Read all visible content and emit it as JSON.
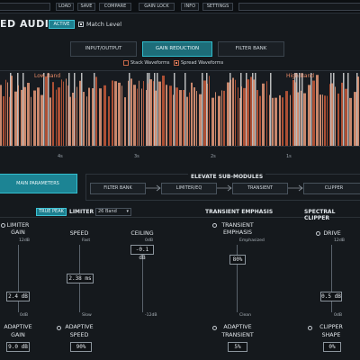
{
  "toolbar": {
    "items": [
      "LOAD",
      "SAVE",
      "COMPARE",
      "GAIN LOCK",
      "INFO",
      "SETTINGS"
    ]
  },
  "header": {
    "brand": "ED AUDIO",
    "active_label": "ACTIVE",
    "match_level_label": "Match Level"
  },
  "tabs": [
    {
      "label": "INPUT/OUTPUT"
    },
    {
      "label": "GAIN REDUCTION"
    },
    {
      "label": "FILTER BANK"
    }
  ],
  "waveform_options": {
    "stack_label": "Stack Waveforms",
    "spread_label": "Spread Waveforms"
  },
  "graph": {
    "low_band_label": "Low Band",
    "high_band_label": "High Band",
    "time_labels": [
      "4s",
      "3s",
      "2s",
      "1s"
    ],
    "colors": {
      "wave": "#c8593a",
      "wave_light": "#e89a7a",
      "bars": "#e3e3e3"
    }
  },
  "modules": {
    "main_params_label": "MAIN PARAMETERS",
    "title": "ELEVATE SUB-MODULES",
    "items": [
      "FILTER BANK",
      "LIMITER/EQ",
      "TRANSIENT",
      "CLIPPER"
    ]
  },
  "limiter": {
    "true_peak_label": "TRUE PEAK",
    "title": "LIMITER",
    "band_select": "26 Band",
    "gain": {
      "label1": "LIMITER",
      "label2": "GAIN",
      "top": "12dB",
      "bottom": "0dB",
      "value": "2.4 dB"
    },
    "speed": {
      "label": "SPEED",
      "top": "Fast",
      "bottom": "Slow",
      "value": "2.38 ms"
    },
    "ceiling": {
      "label": "CEILING",
      "top": "0dB",
      "bottom": "-12dB",
      "value": "-0.1 dB"
    },
    "adaptive_gain": {
      "label1": "ADAPTIVE",
      "label2": "GAIN",
      "value": "9.0 dB"
    },
    "adaptive_speed": {
      "label1": "ADAPTIVE",
      "label2": "SPEED",
      "value": "90%"
    }
  },
  "transient": {
    "title": "TRANSIENT EMPHASIS",
    "emph": {
      "label1": "TRANSIENT",
      "label2": "EMPHASIS",
      "top": "Emphasized",
      "bottom": "Clean",
      "value": "80%"
    },
    "adaptive": {
      "label1": "ADAPTIVE",
      "label2": "TRANSIENT",
      "value": "5%"
    }
  },
  "clipper": {
    "title": "SPECTRAL CLIPPER",
    "drive": {
      "label": "DRIVE",
      "top": "12dB",
      "bottom": "0dB",
      "value": "0.5 dB"
    },
    "shape": {
      "label1": "CLIPPER",
      "label2": "SHAPE",
      "value": "0%"
    }
  }
}
